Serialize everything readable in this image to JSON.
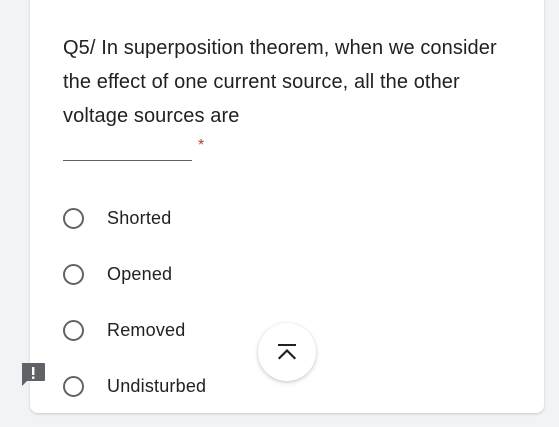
{
  "question": {
    "text": "Q5/ In superposition theorem, when we consider the effect of one current source, all the other voltage sources are",
    "required_marker": "*"
  },
  "options": [
    {
      "label": "Shorted",
      "selected": false
    },
    {
      "label": "Opened",
      "selected": false
    },
    {
      "label": "Removed",
      "selected": false
    },
    {
      "label": "Undisturbed",
      "selected": false
    }
  ],
  "icons": {
    "scroll_top": "arrow-up-to-top-icon",
    "report": "feedback-report-icon"
  },
  "colors": {
    "required": "#d93025",
    "text": "#202124",
    "radio_border": "#5f6368",
    "page_background": "#f1f3f4"
  }
}
